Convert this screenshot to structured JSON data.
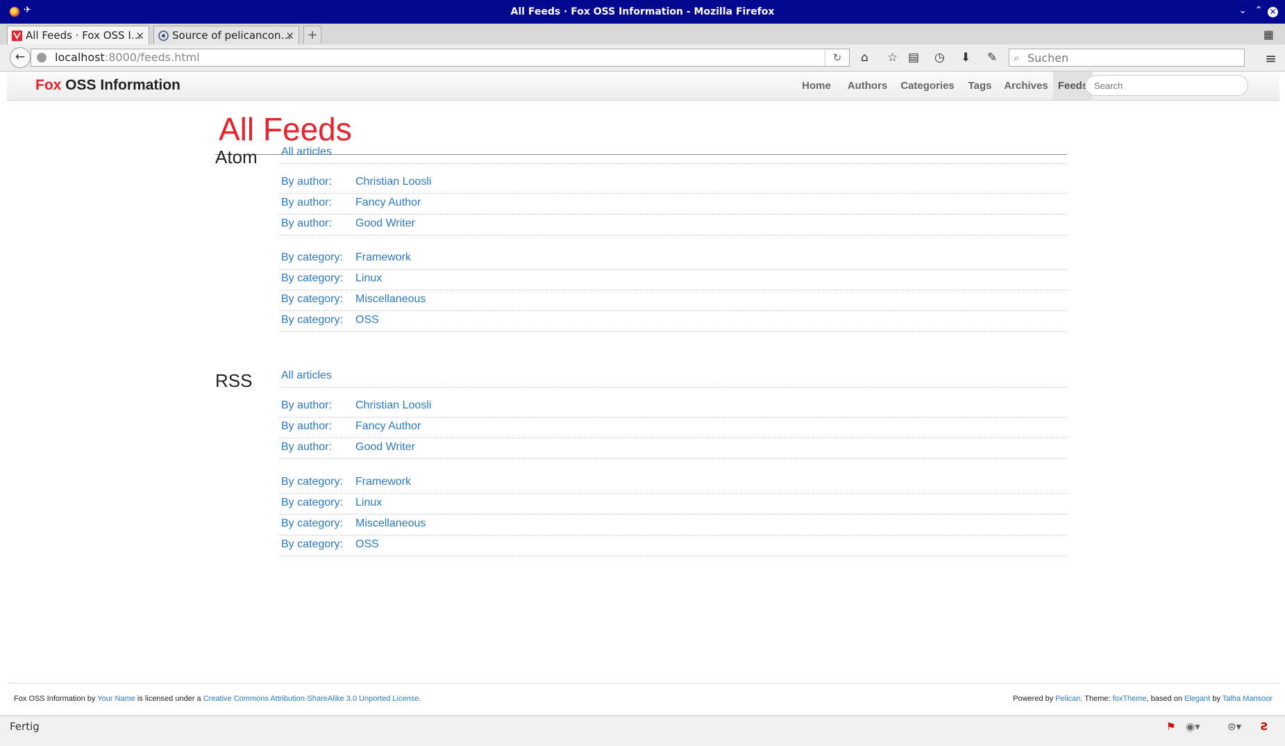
{
  "window": {
    "title": "All Feeds · Fox OSS Information - Mozilla Firefox",
    "controls": [
      "⌄",
      "⌃",
      "✕"
    ]
  },
  "tabs": [
    {
      "label": "All Feeds · Fox OSS I…"
    },
    {
      "label": "Source of pelicancon…"
    }
  ],
  "newtab_label": "+",
  "urlbar": {
    "host": "localhost",
    "rest": ":8000/feeds.html"
  },
  "browser_search": {
    "placeholder": "Suchen"
  },
  "site": {
    "brand_fox": "Fox",
    "brand_rest": " OSS Information",
    "nav": [
      "Home",
      "Authors",
      "Categories",
      "Tags",
      "Archives",
      "Feeds"
    ],
    "search_placeholder": "Search"
  },
  "page": {
    "title": "All Feeds",
    "sections": [
      {
        "heading": "Atom",
        "all": "All articles",
        "authors_label": "By author:",
        "authors": [
          "Christian Loosli",
          "Fancy Author",
          "Good Writer"
        ],
        "categories_label": "By category:",
        "categories": [
          "Framework",
          "Linux",
          "Miscellaneous",
          "OSS"
        ]
      },
      {
        "heading": "RSS",
        "all": "All articles",
        "authors_label": "By author:",
        "authors": [
          "Christian Loosli",
          "Fancy Author",
          "Good Writer"
        ],
        "categories_label": "By category:",
        "categories": [
          "Framework",
          "Linux",
          "Miscellaneous",
          "OSS"
        ]
      }
    ]
  },
  "footer": {
    "left_1": "Fox OSS Information by ",
    "left_link_1": "Your Name",
    "left_2": " is licensed under a ",
    "left_link_2": "Creative Commons Attribution-ShareAlike 3.0 Unported License",
    "left_3": ".",
    "right_1": "Powered by ",
    "right_link_1": "Pelican",
    "right_2": ". Theme: ",
    "right_link_2": "foxTheme",
    "right_3": ", based on ",
    "right_link_3": "Elegant",
    "right_4": " by ",
    "right_link_4": "Talha Mansoor"
  },
  "status": {
    "text": "Fertig"
  },
  "colors": {
    "titlebar": "#03068f",
    "accent_red": "#e8222c",
    "link_blue": "#2a7bc4"
  }
}
